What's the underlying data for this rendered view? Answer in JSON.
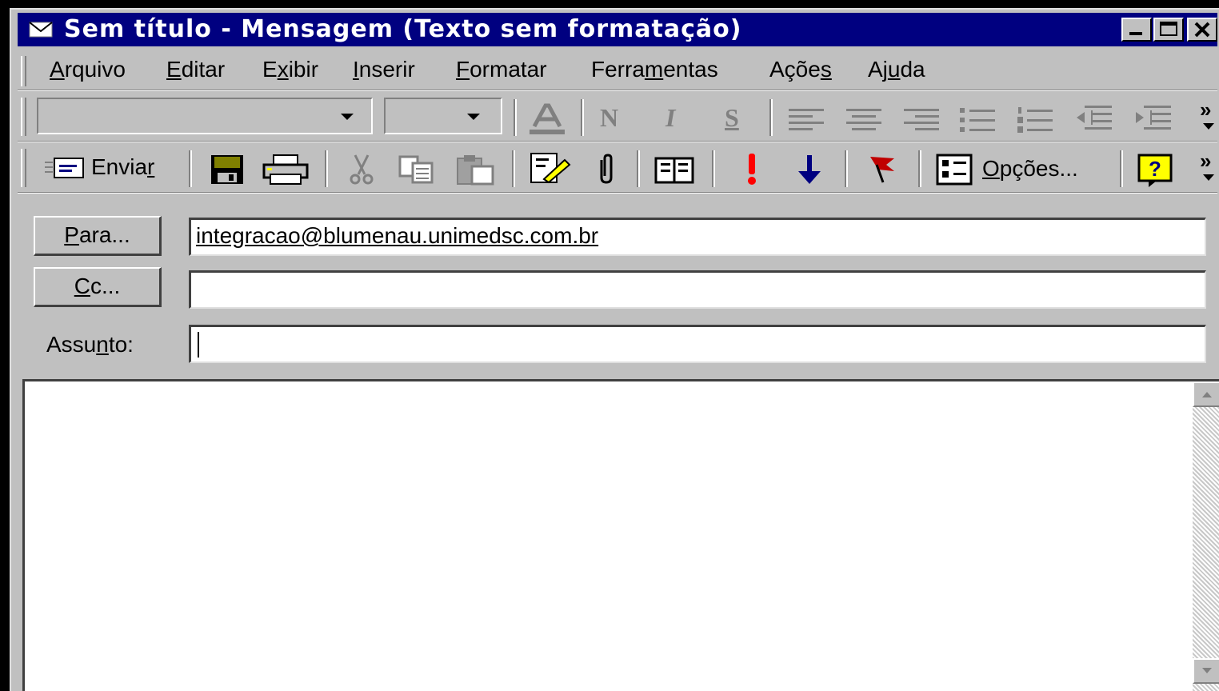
{
  "window": {
    "title": "Sem título - Mensagem (Texto sem formatação)"
  },
  "menu": {
    "items": [
      {
        "label": "Arquivo",
        "key": "A"
      },
      {
        "label": "Editar",
        "key": "E"
      },
      {
        "label": "Exibir",
        "key": "x"
      },
      {
        "label": "Inserir",
        "key": "I"
      },
      {
        "label": "Formatar",
        "key": "F"
      },
      {
        "label": "Ferramentas",
        "key": "m"
      },
      {
        "label": "Ações",
        "key": "s"
      },
      {
        "label": "Ajuda",
        "key": "u"
      }
    ]
  },
  "format_toolbar": {
    "font_value": "",
    "size_value": "",
    "bold_glyph": "N",
    "italic_glyph": "I",
    "underline_glyph": "S",
    "overflow": "»"
  },
  "standard_toolbar": {
    "send_label": "Enviar",
    "options_label": "Opções...",
    "overflow": "»"
  },
  "header": {
    "to_button": "Para...",
    "cc_button": "Cc...",
    "subject_label": "Assunto:",
    "to_value": "integracao@blumenau.unimedsc.com.br",
    "cc_value": "",
    "subject_value": ""
  },
  "body": {
    "text": ""
  },
  "colors": {
    "titlebar": "#000080",
    "chrome": "#c0c0c0",
    "importance_high": "#ff0000",
    "importance_low": "#000080",
    "flag": "#c00000"
  }
}
